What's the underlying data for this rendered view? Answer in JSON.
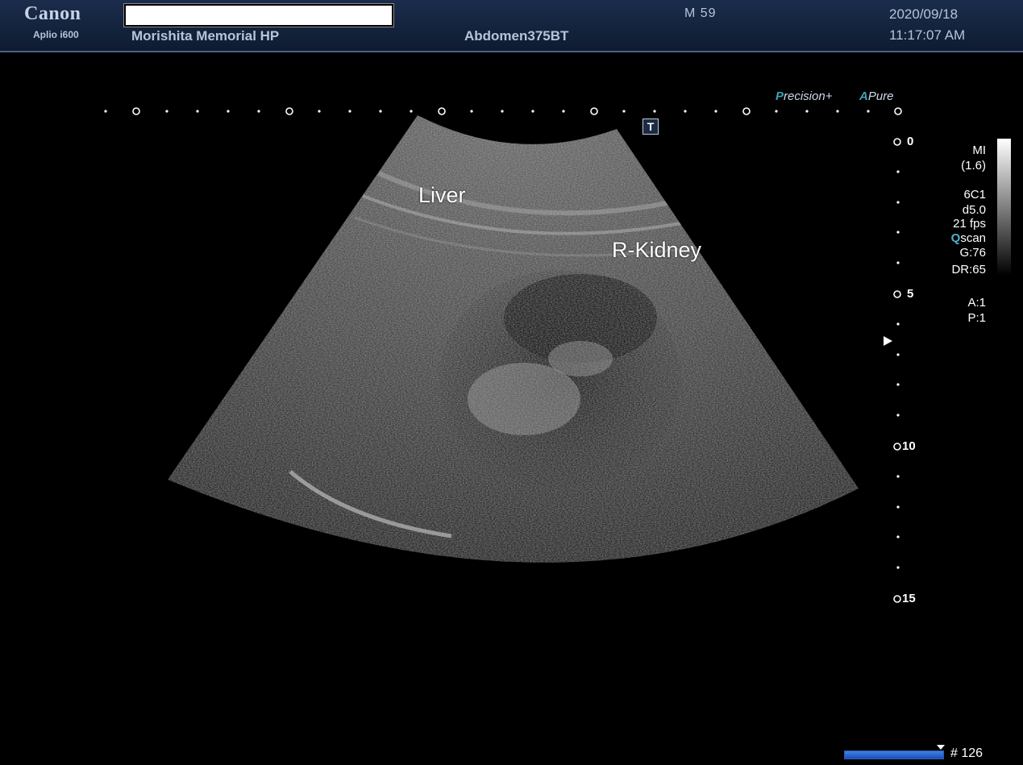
{
  "header": {
    "brand": "Canon",
    "model": "Aplio i600",
    "hospital": "Morishita Memorial HP",
    "preset": "Abdomen375BT",
    "sex_age": "M  59",
    "date": "2020/09/18",
    "time": "11:17:07 AM"
  },
  "badges": {
    "precision_accent": "P",
    "precision_rest": "recision",
    "precision_plus": "+",
    "apure_accent": "A",
    "apure_rest": "Pure",
    "t_marker": "T"
  },
  "annotations": {
    "liver": "Liver",
    "kidney": "R-Kidney"
  },
  "depth_scale": {
    "labels": [
      "0",
      "5",
      "10",
      "15"
    ],
    "unit_hint": "cm"
  },
  "parameters": {
    "mi_label": "MI",
    "mi_value": "(1.6)",
    "probe": "6C1",
    "depth": "d5.0",
    "frame_rate": "21 fps",
    "qscan_q": "Q",
    "qscan_rest": "scan",
    "gain": "G:76",
    "dynamic_range": "DR:65",
    "a_value": "A:1",
    "p_value": "P:1"
  },
  "cine": {
    "frame_counter": "# 126",
    "progress": 1.0
  },
  "colors": {
    "header_bg": "#13233f",
    "header_text": "#b7c3dc",
    "accent_teal": "#3aa3b0",
    "progress_blue": "#2d6fd6"
  }
}
